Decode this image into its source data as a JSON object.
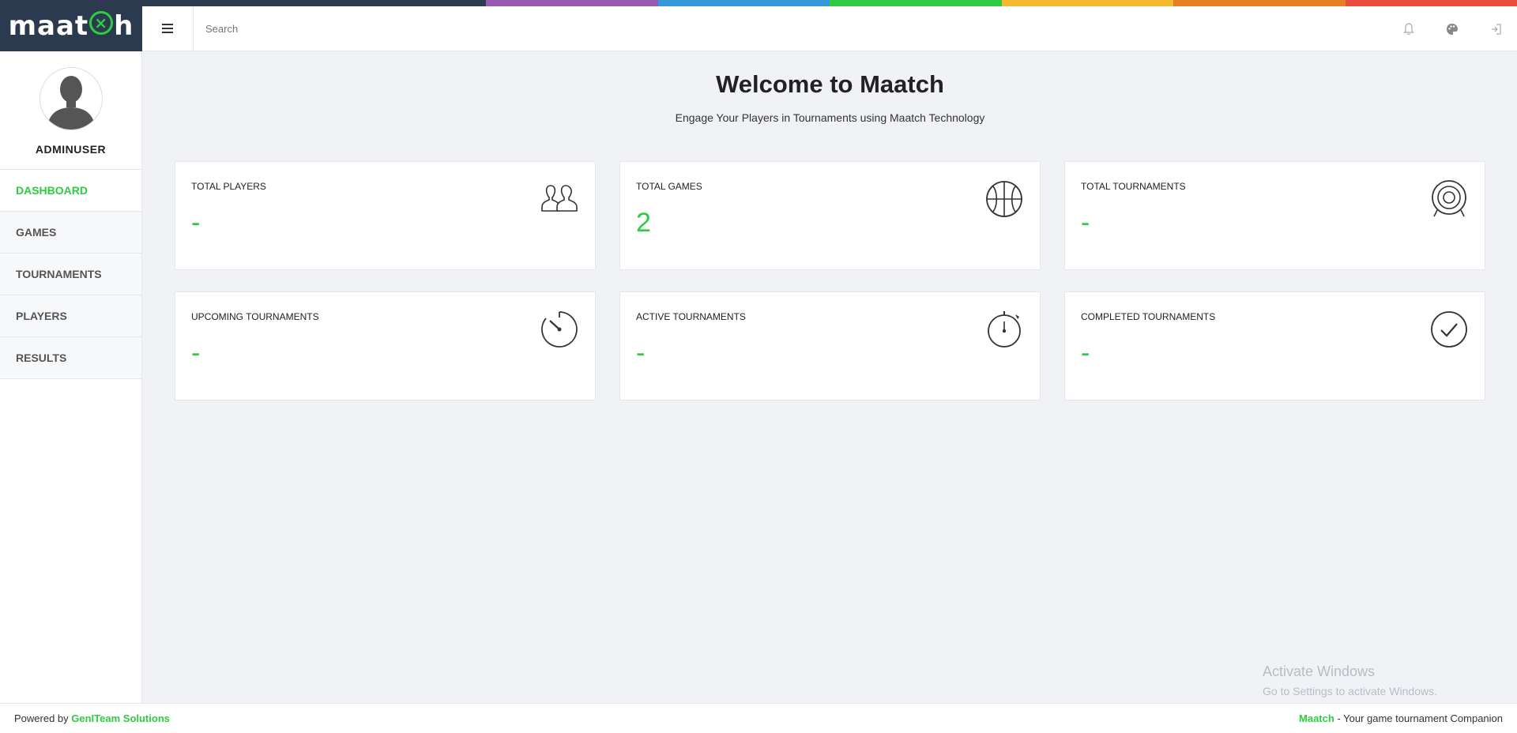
{
  "brand": {
    "logo_left": "maat",
    "logo_mark": "×",
    "logo_right": "h",
    "accent_color": "#2ecc40",
    "sidebar_dark": "#2b3a4e"
  },
  "top_stripe_colors": [
    "#2b3a4e",
    "#2b3a4e",
    "#9b59b6",
    "#3498db",
    "#2ecc40",
    "#f5b82e",
    "#e67e22",
    "#e74c3c"
  ],
  "topbar": {
    "menu_icon": "hamburger-icon",
    "search_placeholder": "Search",
    "icons": [
      "bell-icon",
      "palette-icon",
      "logout-icon"
    ]
  },
  "sidebar": {
    "username": "ADMINUSER",
    "items": [
      {
        "label": "DASHBOARD",
        "active": true
      },
      {
        "label": "GAMES",
        "active": false
      },
      {
        "label": "TOURNAMENTS",
        "active": false
      },
      {
        "label": "PLAYERS",
        "active": false
      },
      {
        "label": "RESULTS",
        "active": false
      }
    ]
  },
  "main": {
    "title": "Welcome to Maatch",
    "subtitle": "Engage Your Players in Tournaments using Maatch Technology",
    "cards": [
      {
        "label": "TOTAL PLAYERS",
        "value": "-",
        "icon": "users-icon"
      },
      {
        "label": "TOTAL GAMES",
        "value": "2",
        "icon": "basketball-icon"
      },
      {
        "label": "TOTAL TOURNAMENTS",
        "value": "-",
        "icon": "target-icon"
      },
      {
        "label": "UPCOMING TOURNAMENTS",
        "value": "-",
        "icon": "timer-icon"
      },
      {
        "label": "ACTIVE TOURNAMENTS",
        "value": "-",
        "icon": "stopwatch-icon"
      },
      {
        "label": "COMPLETED TOURNAMENTS",
        "value": "-",
        "icon": "check-circle-icon"
      }
    ]
  },
  "watermark": {
    "title": "Activate Windows",
    "subtitle": "Go to Settings to activate Windows."
  },
  "footer": {
    "powered_prefix": "Powered by ",
    "powered_company": "GenITeam Solutions",
    "right_brand": "Maatch",
    "right_tagline": " - Your game tournament Companion"
  }
}
